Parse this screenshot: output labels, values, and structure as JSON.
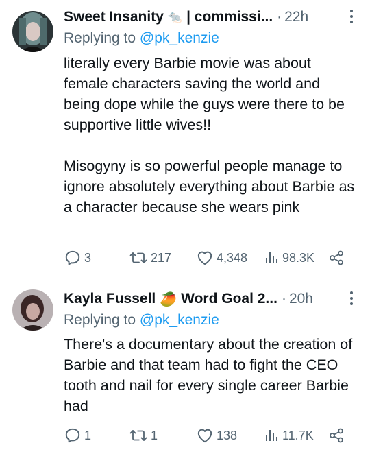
{
  "tweets": [
    {
      "author": "Sweet Insanity",
      "author_emoji": "🐀",
      "author_suffix": "| commissi...",
      "dot": "·",
      "time": "22h",
      "reply_prefix": "Replying to ",
      "reply_handle": "@pk_kenzie",
      "body": "literally every Barbie movie was about female characters saving the world and being dope while the guys were there to be supportive little wives!!\n\nMisogyny is so powerful people manage to ignore absolutely everything about Barbie as a character because she wears pink",
      "replies": "3",
      "retweets": "217",
      "likes": "4,348",
      "views": "98.3K",
      "avatar_colors": [
        "#2a3b3c",
        "#8fa7a8",
        "#1a1a1a"
      ]
    },
    {
      "author": "Kayla Fussell",
      "author_emoji": "🥭",
      "author_suffix": "Word Goal 2...",
      "dot": "·",
      "time": "20h",
      "reply_prefix": "Replying to ",
      "reply_handle": "@pk_kenzie",
      "body": "There's a documentary about the creation of Barbie and that team had to fight the CEO tooth and nail for every single career Barbie had",
      "replies": "1",
      "retweets": "1",
      "likes": "138",
      "views": "11.7K",
      "avatar_colors": [
        "#5a4a48",
        "#b8aeb0",
        "#2a1f1f"
      ]
    }
  ],
  "colors": {
    "text": "#0f1419",
    "muted": "#536471",
    "link": "#1d9bf0",
    "divider": "#eff3f4"
  }
}
